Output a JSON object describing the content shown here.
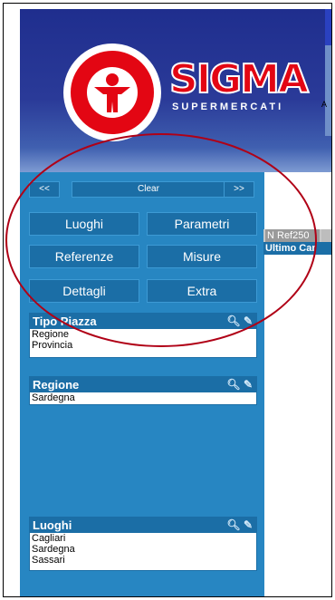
{
  "brand": {
    "name": "SIGMA",
    "tagline": "SUPERMERCATI",
    "accent_red": "#e30613",
    "header_blue": "#1f2e8e",
    "sidebar_blue": "#2786c2",
    "button_blue": "#1b6ea6"
  },
  "header": {
    "right_char": "A"
  },
  "nav": {
    "prev": "<<",
    "clear": "Clear",
    "next": ">>",
    "buttons": {
      "luoghi": "Luoghi",
      "parametri": "Parametri",
      "referenze": "Referenze",
      "misure": "Misure",
      "dettagli": "Dettagli",
      "extra": "Extra"
    }
  },
  "panels": {
    "tipo_piazza": {
      "title": "Tipo Piazza",
      "items": [
        "Regione",
        "Provincia"
      ]
    },
    "regione": {
      "title": "Regione",
      "items": [
        "Sardegna"
      ]
    },
    "luoghi": {
      "title": "Luoghi",
      "items": [
        "Cagliari",
        "Sardegna",
        "Sassari"
      ]
    }
  },
  "icons": {
    "search": "search-icon",
    "eraser": "eraser-icon"
  },
  "main": {
    "tab": "N Ref250",
    "title": "Ultimo Car"
  }
}
